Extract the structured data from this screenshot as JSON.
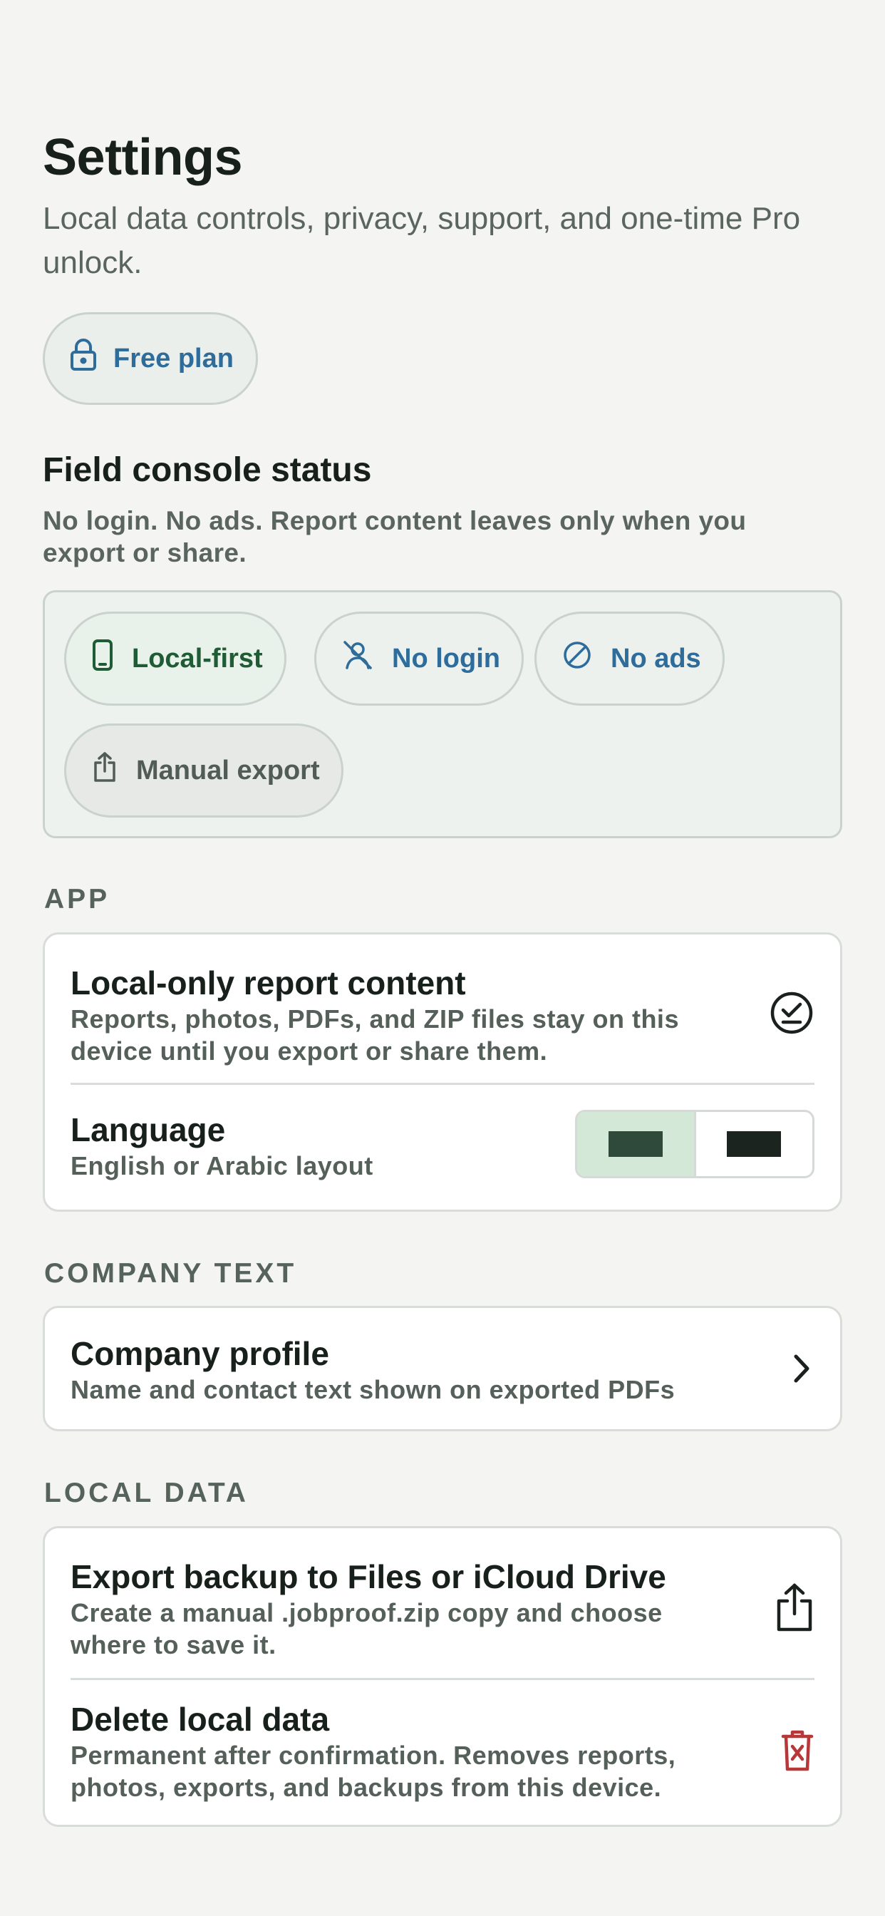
{
  "header": {
    "title": "Settings",
    "subtitle": "Local data controls, privacy, support, and one-time Pro unlock."
  },
  "plan": {
    "label": "Free plan",
    "icon": "lock-icon"
  },
  "status": {
    "heading": "Field console status",
    "description": "No login. No ads. Report content leaves only when you export or share.",
    "chips": [
      {
        "label": "Local-first",
        "icon": "phone-icon"
      },
      {
        "label": "No login",
        "icon": "no-user-icon"
      },
      {
        "label": "No ads",
        "icon": "block-icon"
      },
      {
        "label": "Manual export",
        "icon": "share-icon"
      }
    ]
  },
  "app_section": {
    "label": "APP",
    "local_only": {
      "title": "Local-only report content",
      "description": "Reports, photos, PDFs, and ZIP files stay on this device until you export or share them."
    },
    "language": {
      "title": "Language",
      "description": "English or Arabic layout",
      "selected_index": 0
    }
  },
  "company_section": {
    "label": "COMPANY TEXT",
    "profile": {
      "title": "Company profile",
      "description": "Name and contact text shown on exported PDFs"
    }
  },
  "local_data_section": {
    "label": "LOCAL DATA",
    "export": {
      "title": "Export backup to Files or iCloud Drive",
      "description": "Create a manual .jobproof.zip copy and choose where to save it."
    },
    "delete": {
      "title": "Delete local data",
      "description": "Permanent after confirmation. Removes reports, photos, exports, and backups from this device."
    }
  },
  "colors": {
    "accent_blue": "#2d6c9b",
    "accent_green": "#1f5c35",
    "danger_red": "#b8383a"
  }
}
